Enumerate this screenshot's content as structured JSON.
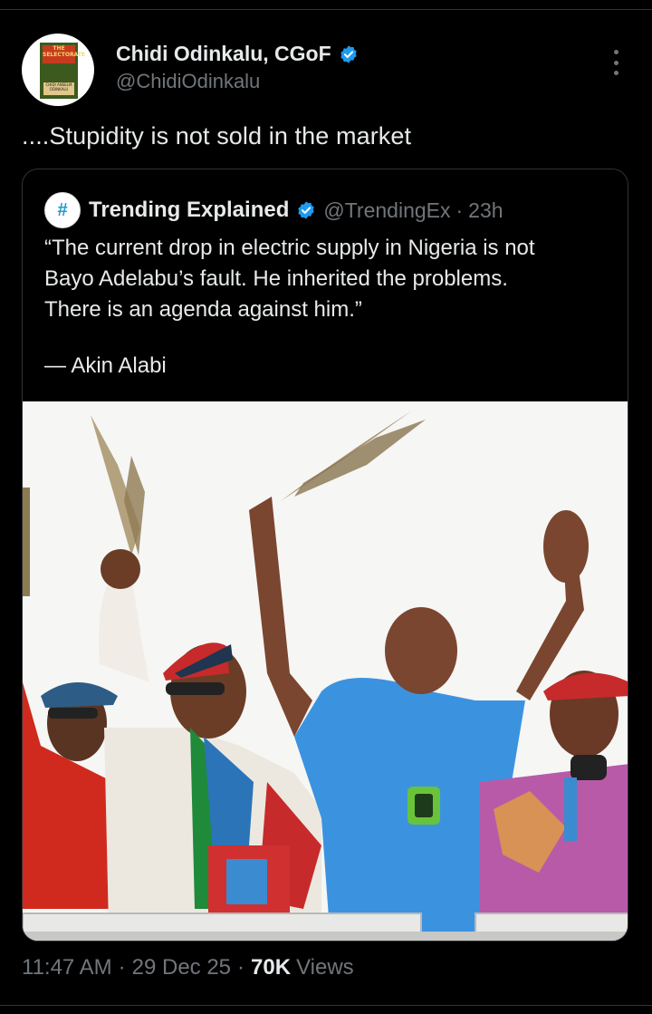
{
  "author": {
    "name": "Chidi Odinkalu, CGoF",
    "handle": "@ChidiOdinkalu",
    "avatar_book_title": "THE SELECTORATE",
    "avatar_book_author": "CHIDI ANSELM ODINKALU"
  },
  "tweet": {
    "text": "....Stupidity is not sold in the market"
  },
  "quoted": {
    "avatar_symbol": "#",
    "name": "Trending Explained",
    "handle": "@TrendingEx",
    "separator": "·",
    "time": "23h",
    "lines": [
      "“The current drop in electric supply in Nigeria is not",
      "Bayo Adelabu’s fault. He inherited the problems.",
      "There is an agenda against him.”"
    ],
    "attribution": "— Akin Alabi"
  },
  "footer": {
    "time": "11:47 AM",
    "separator": "·",
    "date": "29 Dec 25",
    "views_count": "70K",
    "views_label": "Views"
  },
  "colors": {
    "background": "#000000",
    "text": "#e7e9ea",
    "muted": "#71767b",
    "border": "#2f3336",
    "verified": "#1d9bf0"
  }
}
